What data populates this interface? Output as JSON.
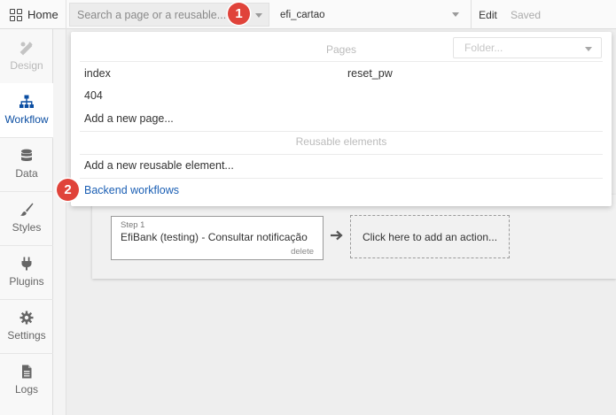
{
  "topbar": {
    "home_label": "Home",
    "search_placeholder": "Search a page or a reusable...",
    "current_page": "efi_cartao",
    "edit_label": "Edit",
    "saved_label": "Saved"
  },
  "sidebar": {
    "items": [
      {
        "label": "Design",
        "icon": "design-icon",
        "state": "disabled"
      },
      {
        "label": "Workflow",
        "icon": "workflow-icon",
        "state": "active"
      },
      {
        "label": "Data",
        "icon": "database-icon",
        "state": "normal"
      },
      {
        "label": "Styles",
        "icon": "brush-icon",
        "state": "normal"
      },
      {
        "label": "Plugins",
        "icon": "plug-icon",
        "state": "normal"
      },
      {
        "label": "Settings",
        "icon": "gear-icon",
        "state": "normal"
      },
      {
        "label": "Logs",
        "icon": "document-icon",
        "state": "normal"
      }
    ]
  },
  "dropdown": {
    "pages_header": "Pages",
    "folder_placeholder": "Folder...",
    "pages": [
      "index",
      "reset_pw",
      "404"
    ],
    "add_page": "Add a new page...",
    "reusable_header": "Reusable elements",
    "add_reusable": "Add a new reusable element...",
    "backend_workflows": "Backend workflows"
  },
  "workflow": {
    "step_label": "Step 1",
    "step_title": "EfiBank (testing) - Consultar notificação",
    "delete_label": "delete",
    "add_action": "Click here to add an action..."
  },
  "badges": [
    "1",
    "2"
  ],
  "colors": {
    "accent": "#0b4ea2",
    "link": "#1b5fb4",
    "badge": "#e0433a"
  }
}
